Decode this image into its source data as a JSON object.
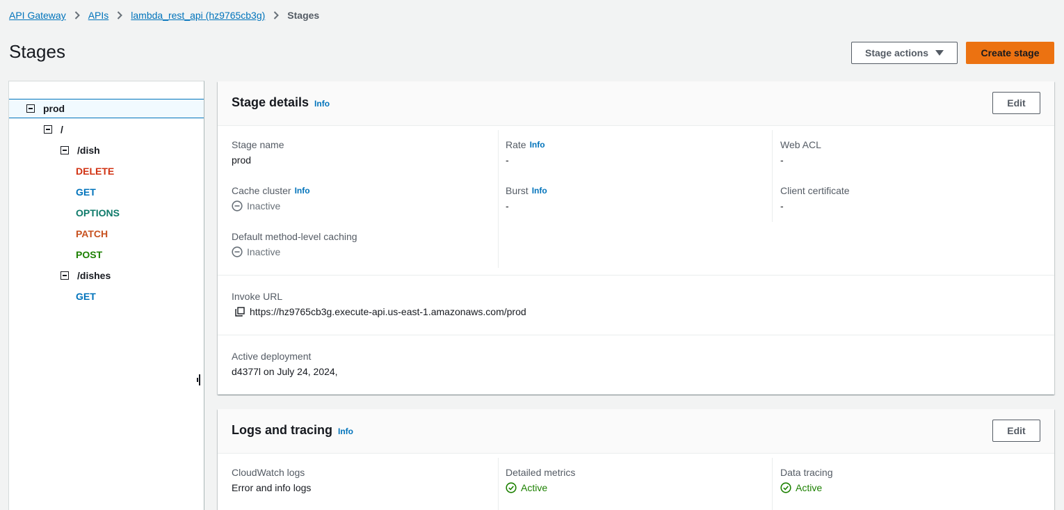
{
  "breadcrumb": {
    "items": [
      "API Gateway",
      "APIs",
      "lambda_rest_api (hz9765cb3g)"
    ],
    "current": "Stages"
  },
  "page": {
    "title": "Stages"
  },
  "actions": {
    "stage_actions": "Stage actions",
    "create_stage": "Create stage"
  },
  "tree": {
    "stage": "prod",
    "root": "/",
    "dish": "/dish",
    "dish_methods": [
      "DELETE",
      "GET",
      "OPTIONS",
      "PATCH",
      "POST"
    ],
    "dishes": "/dishes",
    "dishes_methods": [
      "GET"
    ]
  },
  "stage_details": {
    "title": "Stage details",
    "info": "Info",
    "edit": "Edit",
    "stage_name_label": "Stage name",
    "stage_name": "prod",
    "cache_cluster_label": "Cache cluster",
    "cache_cluster": "Inactive",
    "default_caching_label": "Default method-level caching",
    "default_caching": "Inactive",
    "rate_label": "Rate",
    "rate": "-",
    "burst_label": "Burst",
    "burst": "-",
    "web_acl_label": "Web ACL",
    "web_acl": "-",
    "client_cert_label": "Client certificate",
    "client_cert": "-",
    "invoke_url_label": "Invoke URL",
    "invoke_url": "https://hz9765cb3g.execute-api.us-east-1.amazonaws.com/prod",
    "active_deployment_label": "Active deployment",
    "active_deployment": "d4377l on July 24, 2024,"
  },
  "logs_tracing": {
    "title": "Logs and tracing",
    "info": "Info",
    "edit": "Edit",
    "cloudwatch_label": "CloudWatch logs",
    "cloudwatch": "Error and info logs",
    "detailed_metrics_label": "Detailed metrics",
    "detailed_metrics": "Active",
    "data_tracing_label": "Data tracing",
    "data_tracing": "Active"
  },
  "colors": {
    "link": "#0073bb",
    "primary_button": "#ec7211",
    "delete": "#d13212",
    "get": "#0073bb",
    "options": "#0e7a6a",
    "patch": "#c7511f",
    "post": "#1d8102",
    "active": "#1d8102"
  },
  "icons": [
    "chevron-right-icon",
    "caret-down-icon",
    "collapse-icon",
    "inactive-icon",
    "copy-icon",
    "status-active-icon"
  ]
}
